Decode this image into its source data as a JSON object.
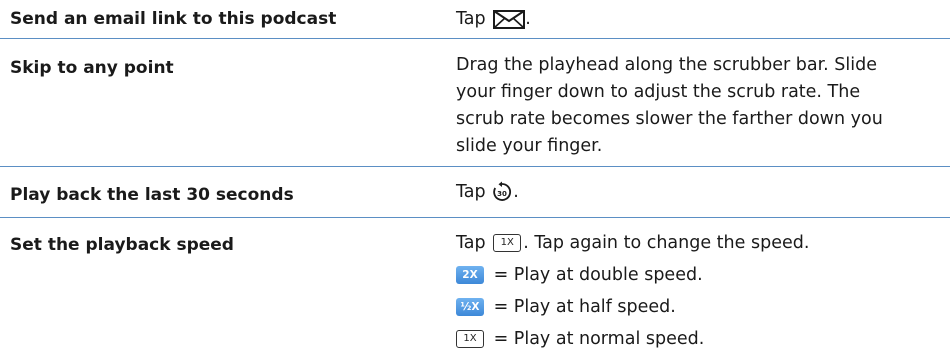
{
  "rows": [
    {
      "action": "Send an email link to this podcast",
      "lines": [
        {
          "before": "Tap ",
          "icon": "mail-icon",
          "after": "."
        }
      ]
    },
    {
      "action": "Skip to any point",
      "lines": [
        {
          "text": "Drag the playhead along the scrubber bar. Slide"
        },
        {
          "text": "your finger down to adjust the scrub rate. The"
        },
        {
          "text": "scrub rate becomes slower the farther down you"
        },
        {
          "text": "slide your finger."
        }
      ]
    },
    {
      "action": "Play back the last 30 seconds",
      "lines": [
        {
          "before": "Tap ",
          "icon": "replay-30-icon",
          "icon_text": "30",
          "after": "."
        }
      ]
    },
    {
      "action": "Set the playback speed",
      "lines": [
        {
          "before": "Tap ",
          "button": "1X",
          "after": ". Tap again to change the speed."
        },
        {
          "button": "2X",
          "after": " = Play at double speed."
        },
        {
          "button": "½X",
          "after": " = Play at half speed."
        },
        {
          "button": "1X",
          "after": " = Play at normal speed."
        }
      ]
    }
  ],
  "colors": {
    "divider": "#5b8fc4",
    "speed_button": "#4b95e0"
  }
}
